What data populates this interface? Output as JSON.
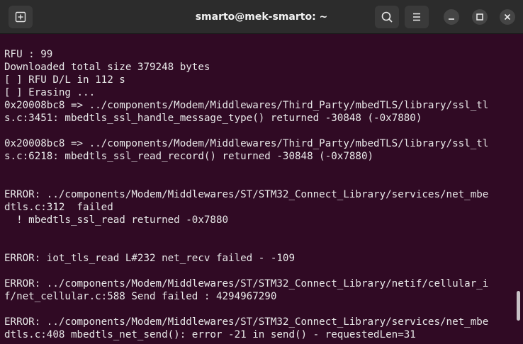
{
  "window": {
    "title": "smarto@mek-smarto: ~",
    "new_tab_icon": "new-tab-icon",
    "search_icon": "search-icon",
    "menu_icon": "hamburger-menu-icon",
    "minimize_icon": "minimize-icon",
    "maximize_icon": "maximize-icon",
    "close_icon": "close-icon"
  },
  "terminal": {
    "lines": [
      "RFU : 99",
      "Downloaded total size 379248 bytes",
      "[ ] RFU D/L in 112 s",
      "[ ] Erasing ...",
      "0x20008bc8 => ../components/Modem/Middlewares/Third_Party/mbedTLS/library/ssl_tl",
      "s.c:3451: mbedtls_ssl_handle_message_type() returned -30848 (-0x7880)",
      "",
      "0x20008bc8 => ../components/Modem/Middlewares/Third_Party/mbedTLS/library/ssl_tl",
      "s.c:6218: mbedtls_ssl_read_record() returned -30848 (-0x7880)",
      "",
      "",
      "ERROR: ../components/Modem/Middlewares/ST/STM32_Connect_Library/services/net_mbe",
      "dtls.c:312  failed",
      "  ! mbedtls_ssl_read returned -0x7880",
      "",
      "",
      "ERROR: iot_tls_read L#232 net_recv failed - -109",
      "",
      "ERROR: ../components/Modem/Middlewares/ST/STM32_Connect_Library/netif/cellular_i",
      "f/net_cellular.c:588 Send failed : 4294967290",
      "",
      "ERROR: ../components/Modem/Middlewares/ST/STM32_Connect_Library/services/net_mbe",
      "dtls.c:408 mbedtls_net_send(): error -21 in send() - requestedLen=31"
    ]
  },
  "colors": {
    "terminal_bg": "#300a24",
    "titlebar_bg": "#2c2c2c",
    "text": "#e8e8e8"
  }
}
